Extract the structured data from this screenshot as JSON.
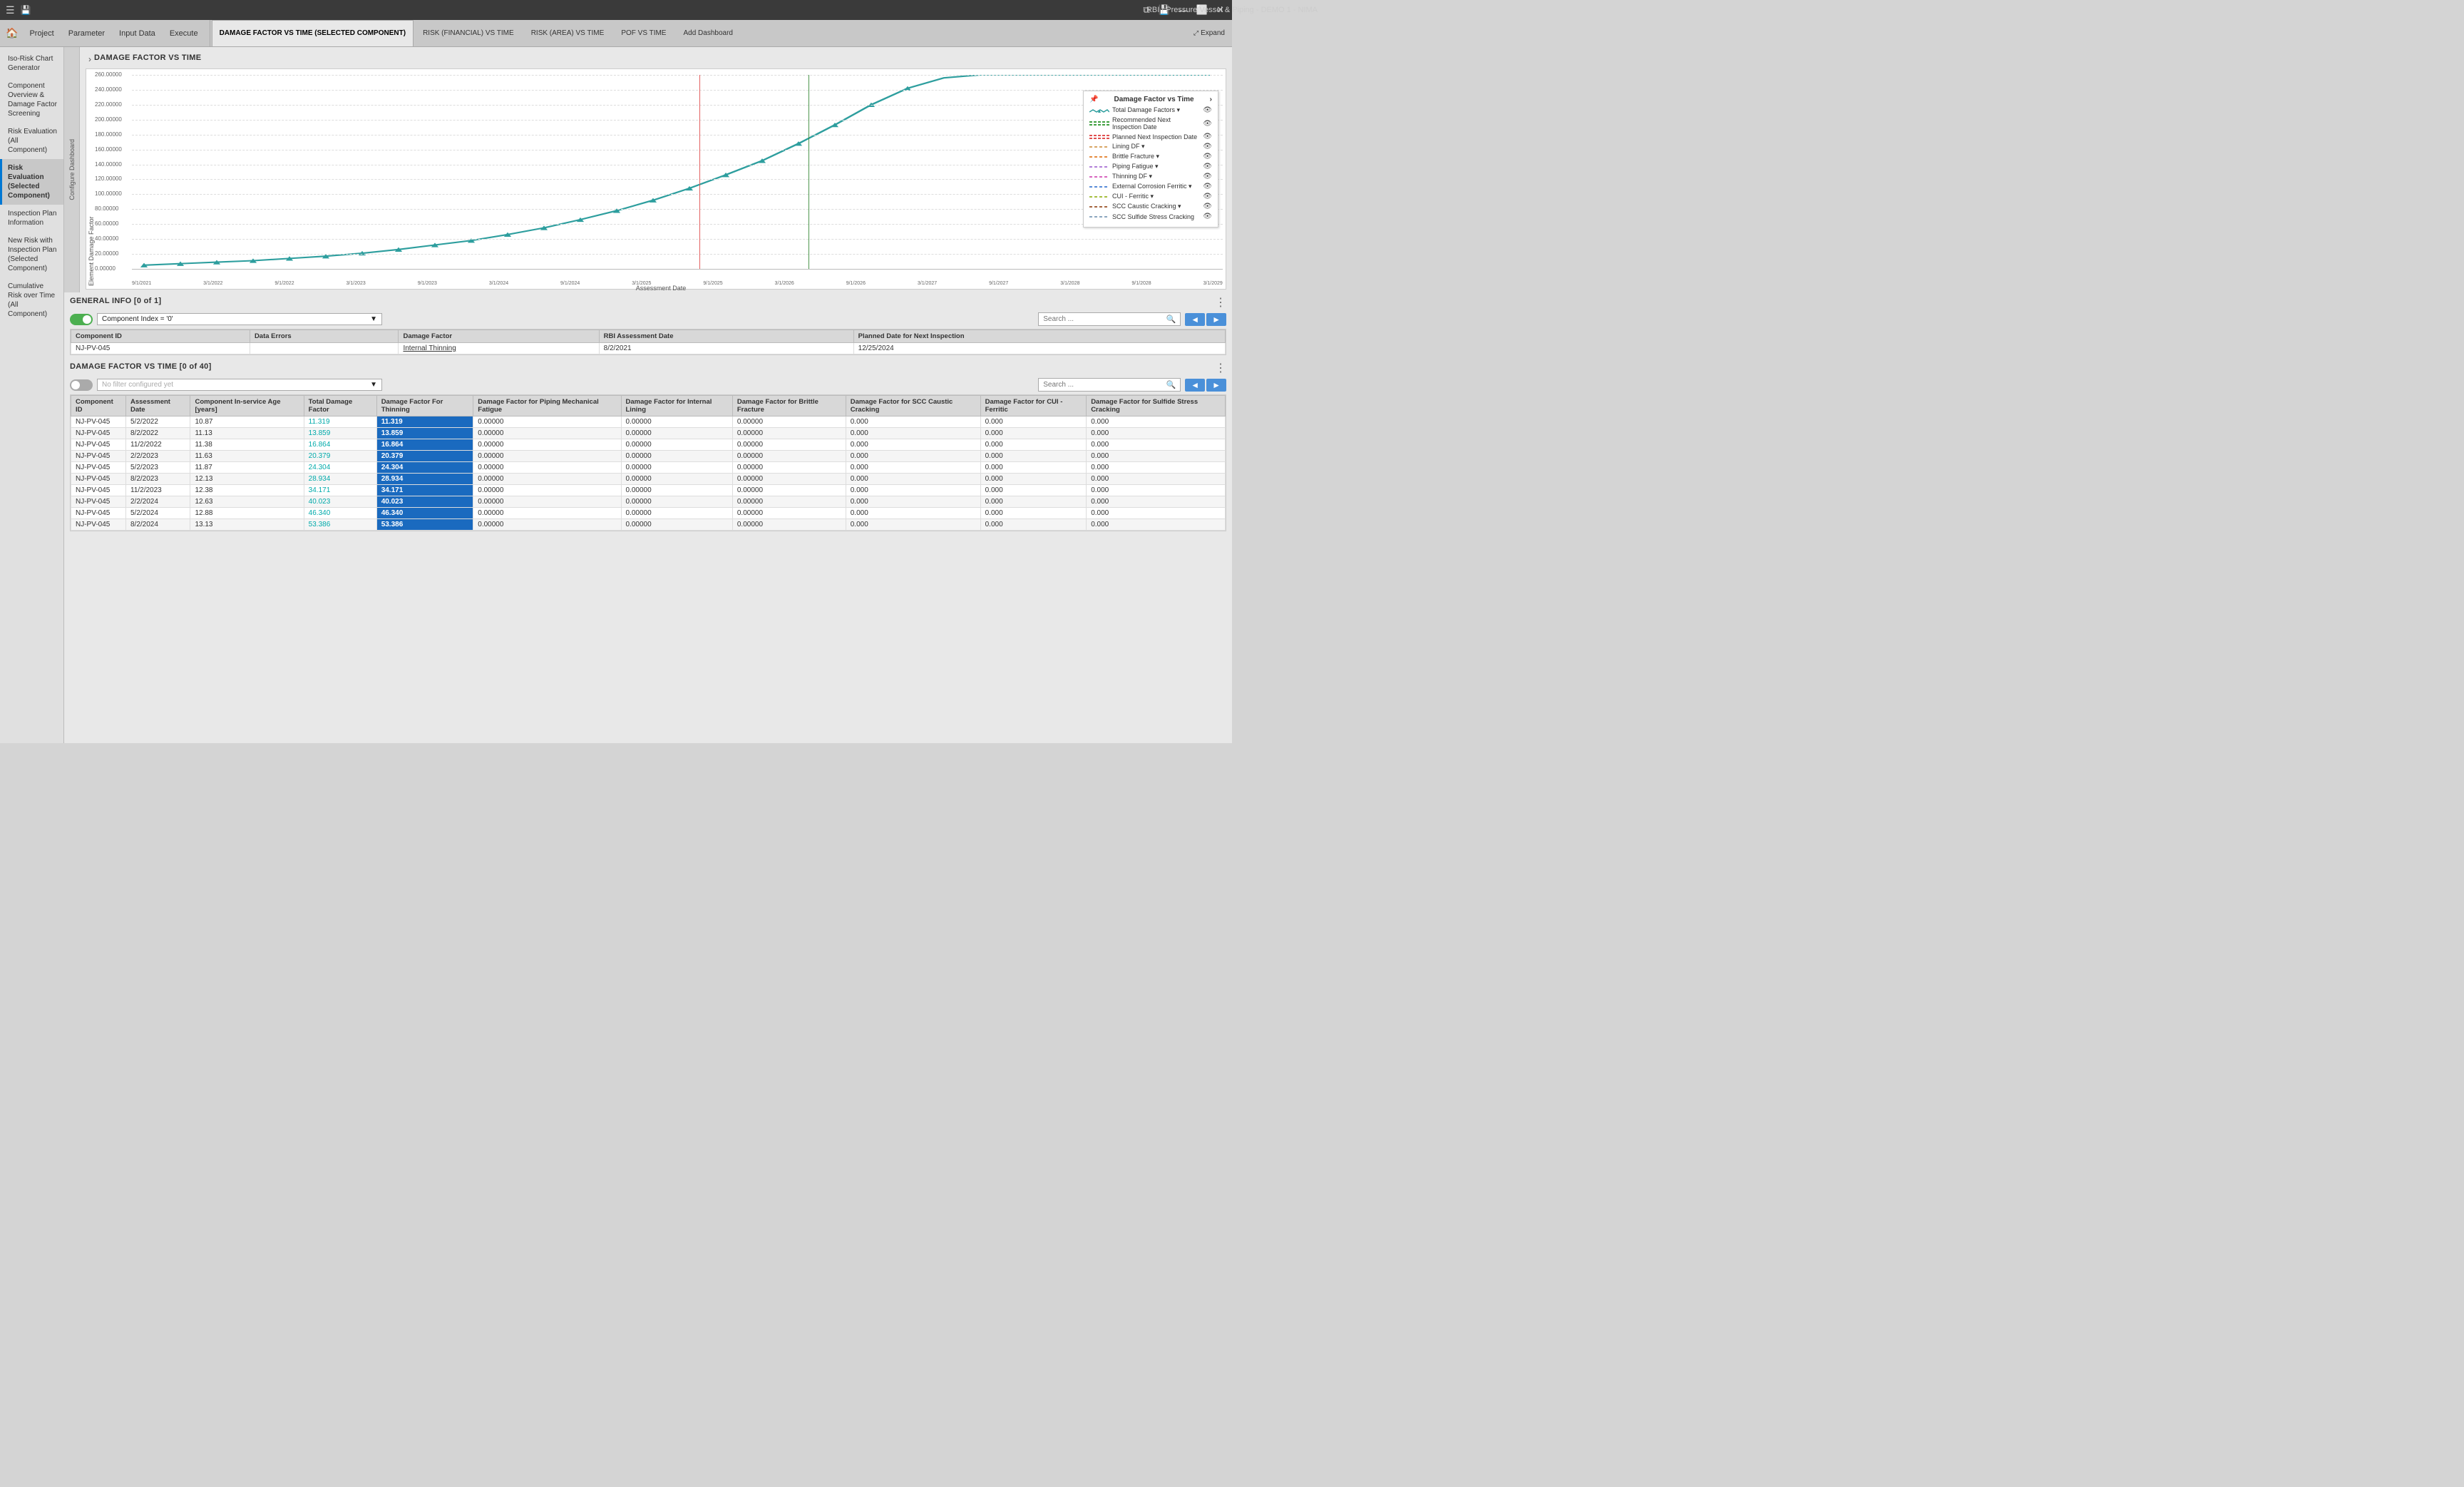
{
  "titleBar": {
    "icon": "📄",
    "title": "RBI | Pressure Vessel & Piping - DEMO 1 - NIMA",
    "controls": [
      "⧉",
      "💾",
      "—",
      "⬜",
      "✕"
    ]
  },
  "tabs": {
    "navItems": [
      {
        "label": "Project",
        "icon": "🏠"
      },
      {
        "label": "Parameter"
      },
      {
        "label": "Input Data"
      },
      {
        "label": "Execute"
      }
    ],
    "tabs": [
      {
        "label": "DAMAGE FACTOR VS TIME (SELECTED COMPONENT)",
        "active": true
      },
      {
        "label": "RISK (FINANCIAL) VS TIME",
        "active": false
      },
      {
        "label": "RISK (AREA) VS TIME",
        "active": false
      },
      {
        "label": "POF VS TIME",
        "active": false
      },
      {
        "label": "Add Dashboard",
        "active": false
      }
    ],
    "expandLabel": "Expand"
  },
  "sidebar": {
    "items": [
      {
        "label": "Iso-Risk Chart Generator",
        "active": false
      },
      {
        "label": "Component Overview & Damage Factor Screening",
        "active": false
      },
      {
        "label": "Risk Evaluation (All Component)",
        "active": false
      },
      {
        "label": "Risk Evaluation (Selected Component)",
        "active": false
      },
      {
        "label": "Inspection Plan Information",
        "active": false
      },
      {
        "label": "New Risk with Inspection Plan (Selected Component)",
        "active": false
      },
      {
        "label": "Cumulative Risk over Time (All Component)",
        "active": false
      }
    ]
  },
  "configureDashboard": {
    "label": "Configure Dashboard"
  },
  "chartSection": {
    "title": "DAMAGE FACTOR VS TIME",
    "yAxisLabel": "Element Damage Factor",
    "xAxisLabel": "Assessment Date",
    "yValues": [
      "260.00000",
      "240.00000",
      "220.00000",
      "200.00000",
      "180.00000",
      "160.00000",
      "140.00000",
      "120.00000",
      "100.00000",
      "80.00000",
      "60.00000",
      "40.00000",
      "20.00000",
      "0.00000"
    ],
    "xLabels": [
      "9/1/2021",
      "3/1/2022",
      "9/1/2022",
      "3/1/2023",
      "9/1/2023",
      "3/1/2024",
      "9/1/2024",
      "3/1/2025",
      "9/1/2025",
      "3/1/2026",
      "9/1/2026",
      "3/1/2027",
      "9/1/2027",
      "3/1/2028",
      "9/1/2028",
      "3/1/2029"
    ]
  },
  "legend": {
    "title": "Damage Factor vs Time",
    "items": [
      {
        "label": "Total Damage Factors ▾",
        "color": "#2d9e9e",
        "type": "teal-line"
      },
      {
        "label": "Recommended Next Inspection Date",
        "color": "#40a040",
        "type": "double-line-green"
      },
      {
        "label": "Planned Next Inspection Date",
        "color": "#e05050",
        "type": "double-line-red"
      },
      {
        "label": "Lining DF ▾",
        "color": "#cc8833",
        "type": "dashed"
      },
      {
        "label": "Brittle Fracture ▾",
        "color": "#dd6600",
        "type": "dashed-orange"
      },
      {
        "label": "Piping Fatigue ▾",
        "color": "#9955cc",
        "type": "dashed-purple"
      },
      {
        "label": "Thinning DF ▾",
        "color": "#cc33aa",
        "type": "dashed-pink"
      },
      {
        "label": "External Corrosion Ferritic ▾",
        "color": "#2266cc",
        "type": "dashed-blue"
      },
      {
        "label": "CUI - Ferritic ▾",
        "color": "#88aa00",
        "type": "dashed-yellow"
      },
      {
        "label": "SCC Caustic Cracking ▾",
        "color": "#883300",
        "type": "dashed-brown"
      },
      {
        "label": "SCC Sulfide Stress Cracking",
        "color": "#6688aa",
        "type": "dashed-grey"
      }
    ]
  },
  "generalInfo": {
    "title": "GENERAL INFO [0 of 1]",
    "toggleOn": true,
    "filterValue": "Component Index = '0'",
    "searchPlaceholder": "Search ...",
    "columns": [
      "Component ID",
      "Data Errors",
      "Damage Factor",
      "RBI Assessment Date",
      "Planned Date for Next Inspection"
    ],
    "rows": [
      {
        "componentId": "NJ-PV-045",
        "dataErrors": "",
        "damageFactor": "Internal Thinning",
        "rbiDate": "8/2/2021",
        "plannedDate": "12/25/2024"
      }
    ]
  },
  "damageTable": {
    "title": "DAMAGE FACTOR VS TIME [0 of 40]",
    "toggleOn": false,
    "filterPlaceholder": "No filter configured yet",
    "searchPlaceholder": "Search ...",
    "columns": [
      "Component ID",
      "Assessment Date",
      "Component In-service Age [years]",
      "Total Damage Factor",
      "Damage Factor For Thinning",
      "Damage Factor for Piping Mechanical Fatigue",
      "Damage Factor for Internal Lining",
      "Damage Factor for Brittle Fracture",
      "Damage Factor for SCC Caustic Cracking",
      "Damage Factor for CUI - Ferritic",
      "Damage Factor for Sulfide Stress Cracking"
    ],
    "rows": [
      {
        "id": "NJ-PV-045",
        "date": "5/2/2022",
        "age": "10.87",
        "total": "11.319",
        "thinning": "11.319",
        "fatigue": "0.00000",
        "lining": "0.00000",
        "brittle": "0.00000",
        "scc": "0.000",
        "cui": "0.000",
        "sulfide": "0.000"
      },
      {
        "id": "NJ-PV-045",
        "date": "8/2/2022",
        "age": "11.13",
        "total": "13.859",
        "thinning": "13.859",
        "fatigue": "0.00000",
        "lining": "0.00000",
        "brittle": "0.00000",
        "scc": "0.000",
        "cui": "0.000",
        "sulfide": "0.000"
      },
      {
        "id": "NJ-PV-045",
        "date": "11/2/2022",
        "age": "11.38",
        "total": "16.864",
        "thinning": "16.864",
        "fatigue": "0.00000",
        "lining": "0.00000",
        "brittle": "0.00000",
        "scc": "0.000",
        "cui": "0.000",
        "sulfide": "0.000"
      },
      {
        "id": "NJ-PV-045",
        "date": "2/2/2023",
        "age": "11.63",
        "total": "20.379",
        "thinning": "20.379",
        "fatigue": "0.00000",
        "lining": "0.00000",
        "brittle": "0.00000",
        "scc": "0.000",
        "cui": "0.000",
        "sulfide": "0.000"
      },
      {
        "id": "NJ-PV-045",
        "date": "5/2/2023",
        "age": "11.87",
        "total": "24.304",
        "thinning": "24.304",
        "fatigue": "0.00000",
        "lining": "0.00000",
        "brittle": "0.00000",
        "scc": "0.000",
        "cui": "0.000",
        "sulfide": "0.000"
      },
      {
        "id": "NJ-PV-045",
        "date": "8/2/2023",
        "age": "12.13",
        "total": "28.934",
        "thinning": "28.934",
        "fatigue": "0.00000",
        "lining": "0.00000",
        "brittle": "0.00000",
        "scc": "0.000",
        "cui": "0.000",
        "sulfide": "0.000"
      },
      {
        "id": "NJ-PV-045",
        "date": "11/2/2023",
        "age": "12.38",
        "total": "34.171",
        "thinning": "34.171",
        "fatigue": "0.00000",
        "lining": "0.00000",
        "brittle": "0.00000",
        "scc": "0.000",
        "cui": "0.000",
        "sulfide": "0.000"
      },
      {
        "id": "NJ-PV-045",
        "date": "2/2/2024",
        "age": "12.63",
        "total": "40.023",
        "thinning": "40.023",
        "fatigue": "0.00000",
        "lining": "0.00000",
        "brittle": "0.00000",
        "scc": "0.000",
        "cui": "0.000",
        "sulfide": "0.000"
      },
      {
        "id": "NJ-PV-045",
        "date": "5/2/2024",
        "age": "12.88",
        "total": "46.340",
        "thinning": "46.340",
        "fatigue": "0.00000",
        "lining": "0.00000",
        "brittle": "0.00000",
        "scc": "0.000",
        "cui": "0.000",
        "sulfide": "0.000"
      },
      {
        "id": "NJ-PV-045",
        "date": "8/2/2024",
        "age": "13.13",
        "total": "53.386",
        "thinning": "53.386",
        "fatigue": "0.00000",
        "lining": "0.00000",
        "brittle": "0.00000",
        "scc": "0.000",
        "cui": "0.000",
        "sulfide": "0.000"
      }
    ]
  }
}
